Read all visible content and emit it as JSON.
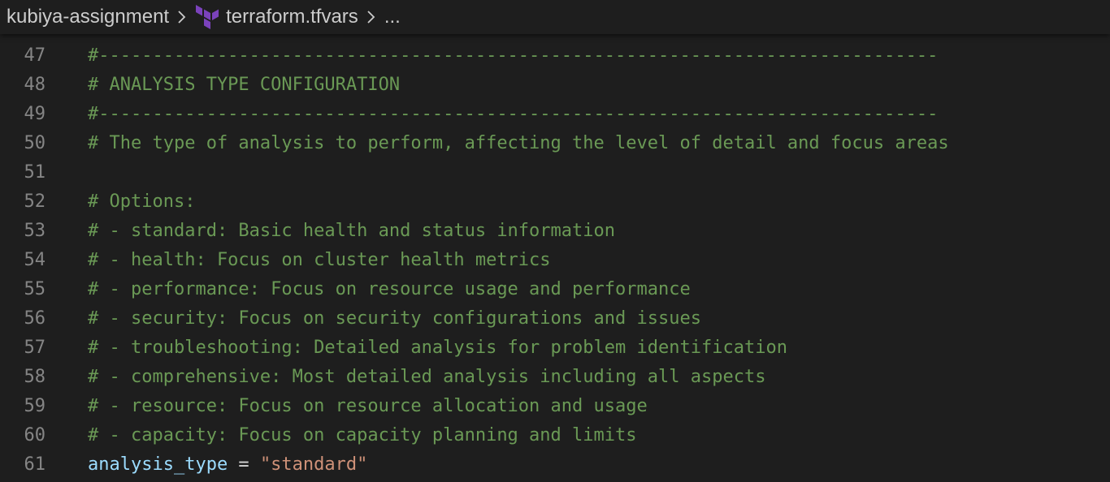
{
  "breadcrumb": {
    "folder": "kubiya-assignment",
    "file": "terraform.tfvars",
    "more": "...",
    "icon_color": "#7b42bc"
  },
  "lines": [
    {
      "num": "47",
      "text": "#------------------------------------------------------------------------------"
    },
    {
      "num": "48",
      "text": "# ANALYSIS TYPE CONFIGURATION"
    },
    {
      "num": "49",
      "text": "#------------------------------------------------------------------------------"
    },
    {
      "num": "50",
      "text": "# The type of analysis to perform, affecting the level of detail and focus areas"
    },
    {
      "num": "51",
      "text": ""
    },
    {
      "num": "52",
      "text": "# Options:"
    },
    {
      "num": "53",
      "text": "# - standard: Basic health and status information"
    },
    {
      "num": "54",
      "text": "# - health: Focus on cluster health metrics"
    },
    {
      "num": "55",
      "text": "# - performance: Focus on resource usage and performance"
    },
    {
      "num": "56",
      "text": "# - security: Focus on security configurations and issues"
    },
    {
      "num": "57",
      "text": "# - troubleshooting: Detailed analysis for problem identification"
    },
    {
      "num": "58",
      "text": "# - comprehensive: Most detailed analysis including all aspects"
    },
    {
      "num": "59",
      "text": "# - resource: Focus on resource allocation and usage"
    },
    {
      "num": "60",
      "text": "# - capacity: Focus on capacity planning and limits"
    }
  ],
  "assignment": {
    "num": "61",
    "name": "analysis_type",
    "operator": " = ",
    "value": "\"standard\""
  },
  "colors": {
    "background": "#1e1e1e",
    "comment": "#6a9955",
    "variable": "#9cdcfe",
    "string": "#ce9178",
    "line_number": "#858585"
  }
}
